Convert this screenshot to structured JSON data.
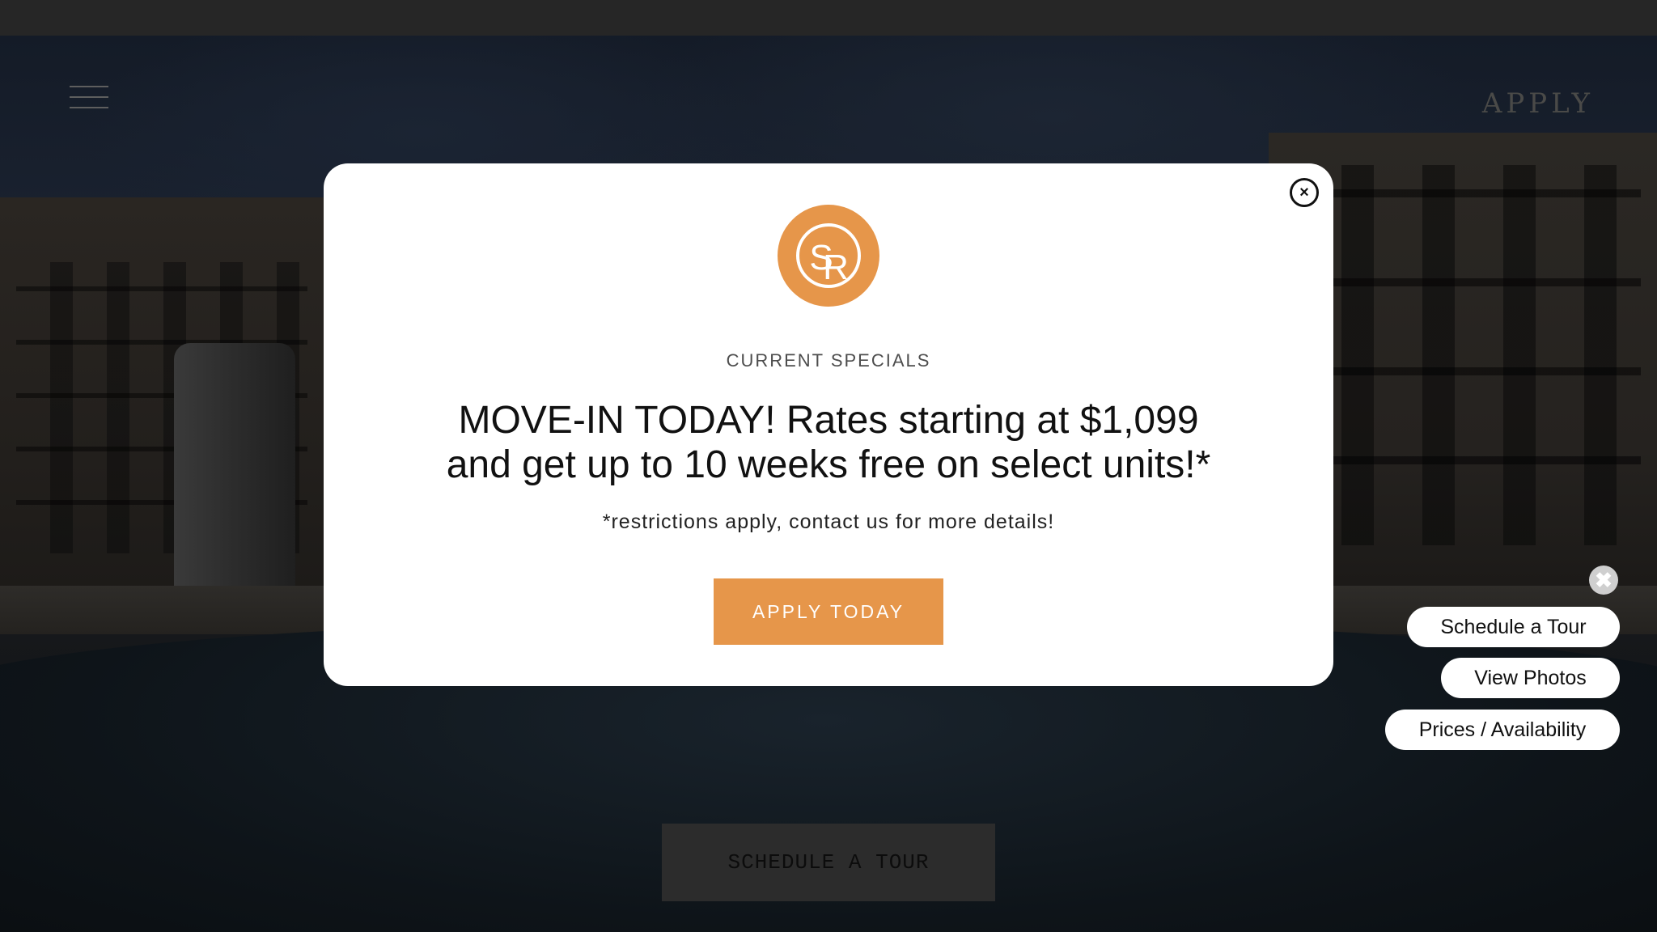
{
  "header": {
    "apply_label": "APPLY"
  },
  "hero": {
    "schedule_tour_label": "SCHEDULE A TOUR"
  },
  "modal": {
    "eyebrow": "CURRENT SPECIALS",
    "headline_line1": "MOVE-IN TODAY! Rates starting at $1,099",
    "headline_line2": "and get up to 10 weeks free on select units!*",
    "disclaimer": "*restrictions apply, contact us for more details!",
    "cta_label": "APPLY TODAY",
    "close_glyph": "×",
    "logo_letters": "SR"
  },
  "widget": {
    "close_glyph": "✖",
    "buttons": [
      {
        "label": "Schedule a Tour"
      },
      {
        "label": "View Photos"
      },
      {
        "label": "Prices / Availability"
      }
    ]
  },
  "colors": {
    "accent": "#e6964a",
    "topbar": "#262626",
    "modal_bg": "#ffffff"
  },
  "icons": {
    "menu": "hamburger-icon",
    "modal_close": "close-icon",
    "widget_close": "close-icon",
    "logo": "sr-monogram-logo"
  }
}
